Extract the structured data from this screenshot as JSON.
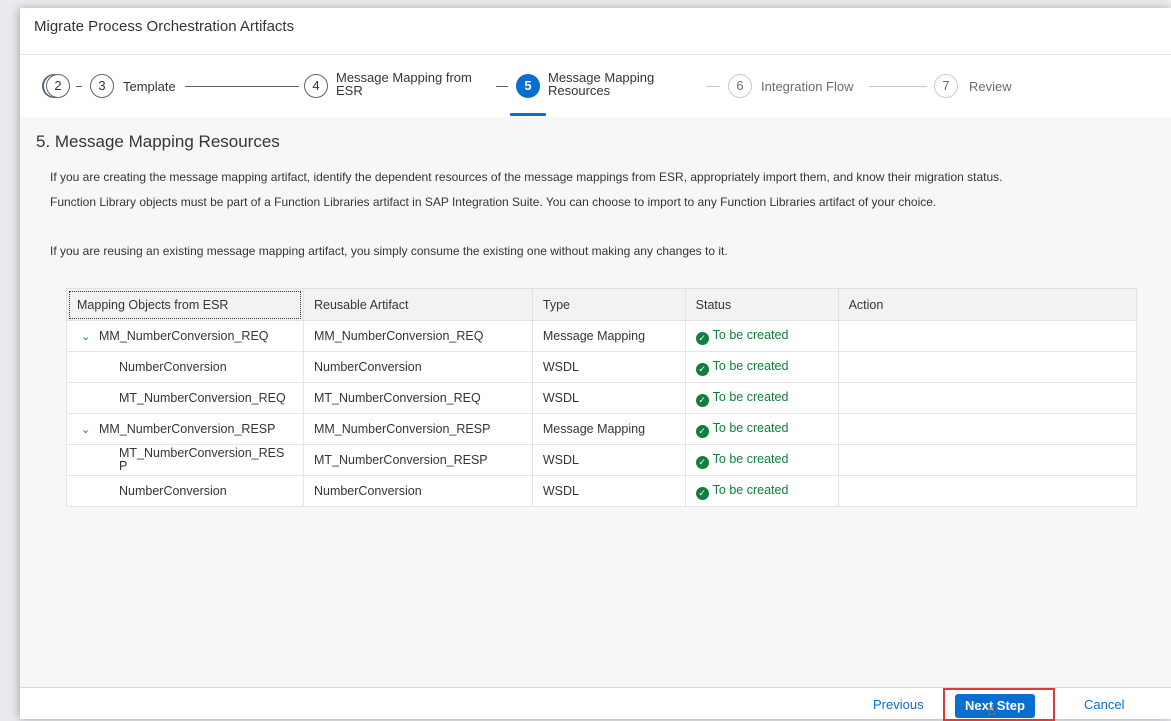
{
  "dialog": {
    "title": "Migrate Process Orchestration Artifacts"
  },
  "wizard": {
    "steps": [
      {
        "number": "2",
        "label": ""
      },
      {
        "number": "3",
        "label": "Template"
      },
      {
        "number": "4",
        "label_line1": "Message Mapping from",
        "label_line2": "ESR"
      },
      {
        "number": "5",
        "label_line1": "Message Mapping",
        "label_line2": "Resources"
      },
      {
        "number": "6",
        "label": "Integration Flow"
      },
      {
        "number": "7",
        "label": "Review"
      }
    ]
  },
  "page": {
    "title": "5. Message Mapping Resources",
    "para1_line1": "If you are creating the message mapping artifact, identify the dependent resources of the message mappings from ESR, appropriately import them, and know their migration status.",
    "para1_line2": "Function Library objects must be part of a Function Libraries artifact in SAP Integration Suite. You can choose to import to any Function Libraries artifact of your choice.",
    "para2": "If you are reusing an existing message mapping artifact, you simply consume the existing one without making any changes to it."
  },
  "table": {
    "columns": [
      "Mapping Objects from ESR",
      "Reusable Artifact",
      "Type",
      "Status",
      "Action"
    ],
    "rows": [
      {
        "mapping": "MM_NumberConversion_REQ",
        "artifact": "MM_NumberConversion_REQ",
        "type": "Message Mapping",
        "status": "To be created",
        "action": ""
      },
      {
        "mapping": "NumberConversion",
        "artifact": "NumberConversion",
        "type": "WSDL",
        "status": "To be created",
        "action": ""
      },
      {
        "mapping": "MT_NumberConversion_REQ",
        "artifact": "MT_NumberConversion_REQ",
        "type": "WSDL",
        "status": "To be created",
        "action": ""
      },
      {
        "mapping": "MM_NumberConversion_RESP",
        "artifact": "MM_NumberConversion_RESP",
        "type": "Message Mapping",
        "status": "To be created",
        "action": ""
      },
      {
        "mapping_line1": "MT_NumberConversion_RES",
        "mapping_line2": "P",
        "artifact": "MT_NumberConversion_RESP",
        "type": "WSDL",
        "status": "To be created",
        "action": ""
      },
      {
        "mapping": "NumberConversion",
        "artifact": "NumberConversion",
        "type": "WSDL",
        "status": "To be created",
        "action": ""
      }
    ]
  },
  "footer": {
    "previous_label": "Previous",
    "next_label": "Next Step",
    "cancel_label": "Cancel"
  },
  "colors": {
    "accent": "#0a6ed1",
    "success": "#107e3e",
    "highlight": "#e03b3b"
  }
}
